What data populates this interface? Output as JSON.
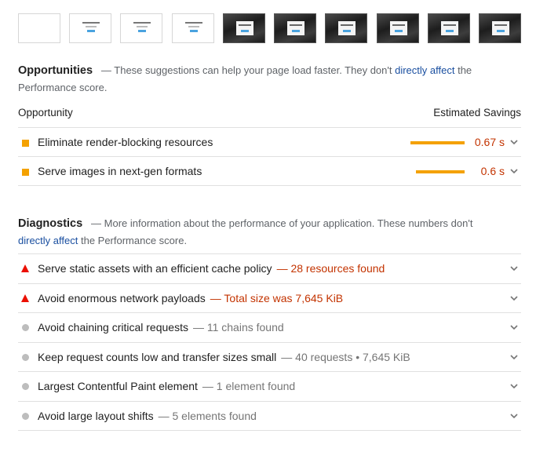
{
  "filmstrip": {
    "frames": [
      "blank",
      "light",
      "light",
      "light",
      "dark",
      "dark",
      "dark",
      "dark",
      "dark",
      "dark"
    ]
  },
  "opportunities": {
    "title": "Opportunities",
    "desc_prefix": "— These suggestions can help your page load faster. They don't ",
    "desc_link": "directly affect",
    "desc_suffix": " the Performance score.",
    "col_opportunity": "Opportunity",
    "col_savings": "Estimated Savings",
    "items": [
      {
        "label": "Eliminate render-blocking resources",
        "savings": "0.67 s",
        "bar_fraction": 1.0
      },
      {
        "label": "Serve images in next-gen formats",
        "savings": "0.6 s",
        "bar_fraction": 0.9
      }
    ]
  },
  "diagnostics": {
    "title": "Diagnostics",
    "desc_prefix": "— More information about the performance of your application. These numbers don't ",
    "desc_link": "directly affect",
    "desc_suffix": " the Performance score.",
    "items": [
      {
        "label": "Serve static assets with an efficient cache policy",
        "display": "— 28 resources found",
        "status": "fail"
      },
      {
        "label": "Avoid enormous network payloads",
        "display": "— Total size was 7,645 KiB",
        "status": "fail"
      },
      {
        "label": "Avoid chaining critical requests",
        "display": "— 11 chains found",
        "status": "info"
      },
      {
        "label": "Keep request counts low and transfer sizes small",
        "display": "— 40 requests • 7,645 KiB",
        "status": "info"
      },
      {
        "label": "Largest Contentful Paint element",
        "display": "— 1 element found",
        "status": "info"
      },
      {
        "label": "Avoid large layout shifts",
        "display": "— 5 elements found",
        "status": "info"
      }
    ]
  },
  "colors": {
    "warn": "#f4a100",
    "fail": "#eb0f00",
    "fail_text": "#c33300",
    "info": "#bdbdbd",
    "link": "#1a4fa0"
  }
}
